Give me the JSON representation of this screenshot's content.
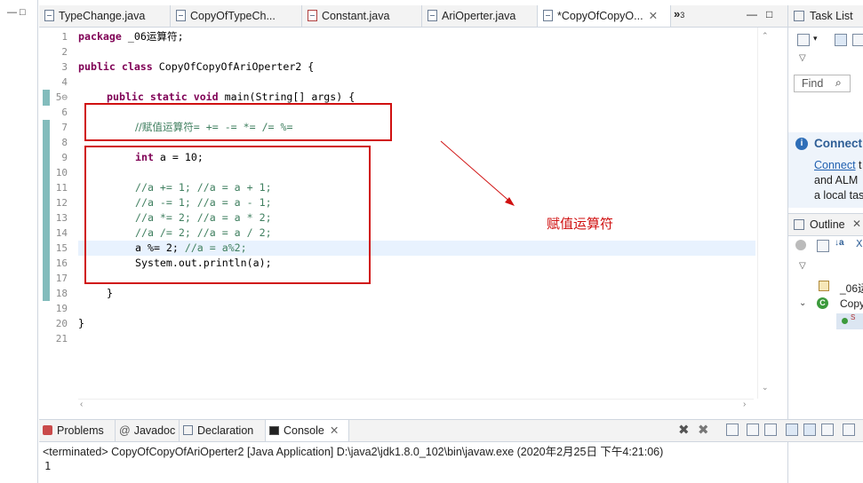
{
  "left_strip": {
    "minimize": "—",
    "maximize": "□"
  },
  "editor_tabs": [
    {
      "label": "TypeChange.java",
      "icon": "java-file-icon",
      "active": false
    },
    {
      "label": "CopyOfTypeCh...",
      "icon": "java-file-icon",
      "active": false
    },
    {
      "label": "Constant.java",
      "icon": "java-file-error-icon",
      "active": false
    },
    {
      "label": "AriOperter.java",
      "icon": "java-file-icon",
      "active": false
    },
    {
      "label": "*CopyOfCopyO...",
      "icon": "java-file-icon",
      "active": true,
      "close": "✕"
    }
  ],
  "overflow": {
    "chevron": "»",
    "count": "3"
  },
  "editor_controls": {
    "minimize": "—",
    "maximize": "□"
  },
  "lines": [
    {
      "n": "1"
    },
    {
      "n": "2"
    },
    {
      "n": "3"
    },
    {
      "n": "4"
    },
    {
      "n": "5⊖"
    },
    {
      "n": "6"
    },
    {
      "n": "7"
    },
    {
      "n": "8"
    },
    {
      "n": "9"
    },
    {
      "n": "10"
    },
    {
      "n": "11"
    },
    {
      "n": "12"
    },
    {
      "n": "13"
    },
    {
      "n": "14"
    },
    {
      "n": "15"
    },
    {
      "n": "16"
    },
    {
      "n": "17"
    },
    {
      "n": "18"
    },
    {
      "n": "19"
    },
    {
      "n": "20"
    },
    {
      "n": "21"
    }
  ],
  "code": {
    "l1_kw": "package",
    "l1_rest": " _06运算符;",
    "l3_kw": "public class",
    "l3_rest": " CopyOfCopyOfAriOperter2 {",
    "l5_kw": "public static void",
    "l5_rest": " main(String[] args) {",
    "l7_comment_cn": "//赋值运算符",
    "l7_comment_ops": "= += -= *= /= %=",
    "l9_kw": "int",
    "l9_rest": " a = 10;",
    "l11": "//a += 1; //a = a + 1;",
    "l12": "//a -= 1; //a = a - 1;",
    "l13": "//a *= 2; //a = a * 2;",
    "l14": "//a /= 2; //a = a / 2;",
    "l15_code": "a %= 2; ",
    "l15_comment": "//a = a%2;",
    "l16": "System.out.println(a);",
    "l18": "}",
    "l20": "}"
  },
  "annotation": {
    "text": "赋值运算符",
    "color": "#d01010"
  },
  "right_panel": {
    "task_list_tab": "Task List",
    "find_placeholder": "Find",
    "connect_title": "Connect",
    "connect_link": "Connect",
    "connect_line1_tail": " t",
    "connect_line2": "and ALM",
    "connect_line3": "a local tas",
    "outline_tab": "Outline",
    "outline_package": "_06运",
    "outline_class": "Copy",
    "outline_method_marker": "S"
  },
  "console_tabs": [
    {
      "label": "Problems",
      "icon": "problems-icon",
      "active": false
    },
    {
      "label": "Javadoc",
      "icon": "at-icon",
      "active": false
    },
    {
      "label": "Declaration",
      "icon": "declaration-icon",
      "active": false
    },
    {
      "label": "Console",
      "icon": "console-icon",
      "active": true,
      "close": "✕"
    }
  ],
  "console": {
    "header": "<terminated> CopyOfCopyOfAriOperter2 [Java Application] D:\\java2\\jdk1.8.0_102\\bin\\javaw.exe (2020年2月25日 下午4:21:06)",
    "output": "1"
  }
}
